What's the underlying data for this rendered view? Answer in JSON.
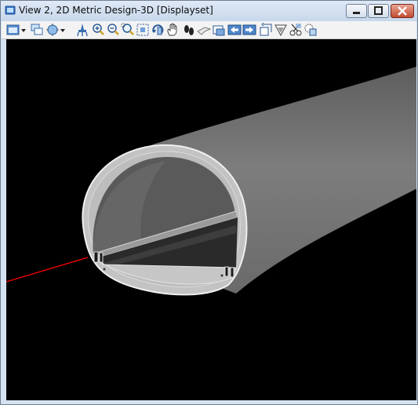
{
  "window": {
    "title": "View 2, 2D Metric Design-3D [Displayset]"
  },
  "toolbar": {
    "buttons": [
      {
        "icon": "view-attributes-icon"
      },
      {
        "icon": "dropdown-arrow-icon"
      },
      {
        "icon": "level-display-icon"
      },
      {
        "icon": "display-style-icon"
      },
      {
        "icon": "dropdown-arrow-icon"
      },
      {
        "icon": "update-view-icon"
      },
      {
        "icon": "zoom-in-icon"
      },
      {
        "icon": "zoom-out-icon"
      },
      {
        "icon": "window-area-icon"
      },
      {
        "icon": "fit-view-icon"
      },
      {
        "icon": "rotate-view-icon"
      },
      {
        "icon": "pan-view-icon"
      },
      {
        "icon": "walk-icon"
      },
      {
        "icon": "fly-icon"
      },
      {
        "icon": "view-camera-icon"
      },
      {
        "icon": "previous-view-icon"
      },
      {
        "icon": "next-view-icon"
      },
      {
        "icon": "view-rotation-icon"
      },
      {
        "icon": "camera-view-icon"
      },
      {
        "icon": "clip-volume-icon"
      },
      {
        "icon": "clip-mask-icon"
      }
    ]
  },
  "colors": {
    "viewport_background": "#000000",
    "tunnel_surface": "#7f7f7f",
    "tunnel_lining": "#bfbfbf",
    "tunnel_outline": "#e6e6e6",
    "leader_line": "#ff0000"
  }
}
